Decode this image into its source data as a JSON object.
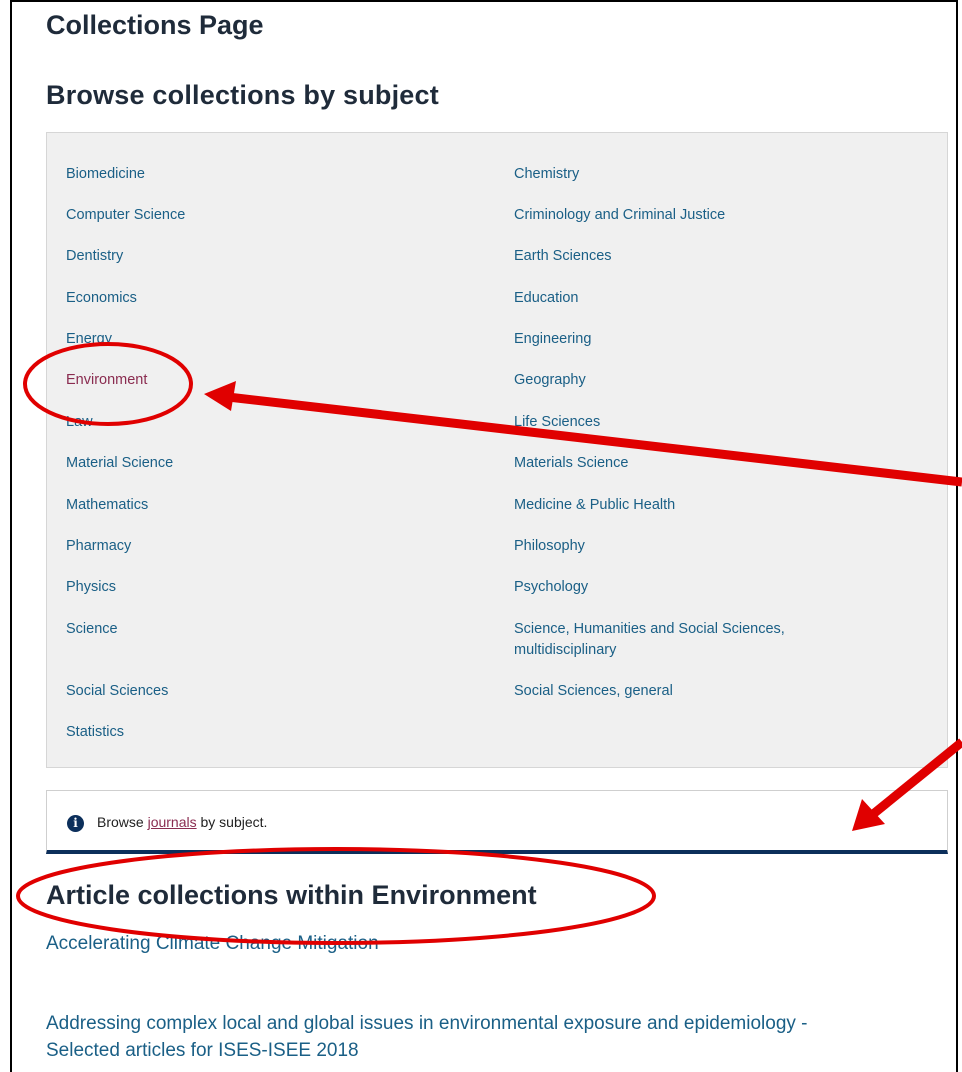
{
  "page": {
    "title": "Collections Page"
  },
  "browse": {
    "heading": "Browse collections by subject",
    "left_column": [
      "Biomedicine",
      "Computer Science",
      "Dentistry",
      "Economics",
      "Energy",
      "Environment",
      "Law",
      "Material Science",
      "Mathematics",
      "Pharmacy",
      "Physics",
      "Science",
      "Social Sciences",
      "Statistics"
    ],
    "right_column": [
      "Chemistry",
      "Criminology and Criminal Justice",
      "Earth Sciences",
      "Education",
      "Engineering",
      "Geography",
      "Life Sciences",
      "Materials Science",
      "Medicine & Public Health",
      "Philosophy",
      "Psychology",
      "Science, Humanities and Social Sciences,",
      "multidisciplinary",
      "Social Sciences, general"
    ]
  },
  "info": {
    "prefix": "Browse ",
    "link": "journals",
    "suffix": " by subject."
  },
  "collections": {
    "heading": "Article collections within Environment",
    "items": [
      "Accelerating Climate Change Mitigation",
      "Addressing complex local and global issues in environmental exposure and epidemiology -",
      "Selected articles for ISES-ISEE 2018"
    ]
  },
  "colors": {
    "link": "#1a5f86",
    "visited_link": "#8a2c50",
    "heading": "#1f2b3a",
    "annotation_red": "#e00000",
    "info_border": "#0c2f5b"
  }
}
